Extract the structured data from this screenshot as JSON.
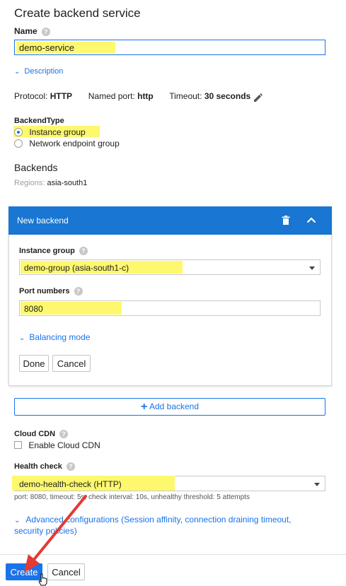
{
  "title": "Create backend service",
  "name": {
    "label": "Name",
    "value": "demo-service"
  },
  "description_link": "Description",
  "protocol": {
    "protocol_label": "Protocol:",
    "protocol_value": "HTTP",
    "port_label": "Named port:",
    "port_value": "http",
    "timeout_label": "Timeout:",
    "timeout_value": "30 seconds"
  },
  "backend_type": {
    "label": "BackendType",
    "options": [
      "Instance group",
      "Network endpoint group"
    ],
    "selected": "Instance group"
  },
  "backends": {
    "heading": "Backends",
    "regions_label": "Regions:",
    "regions_value": "asia-south1"
  },
  "new_backend": {
    "header": "New backend",
    "instance_group_label": "Instance group",
    "instance_group_value": "demo-group (asia-south1-c)",
    "port_numbers_label": "Port numbers",
    "port_numbers_value": "8080",
    "balancing_mode_link": "Balancing mode",
    "done_label": "Done",
    "cancel_label": "Cancel"
  },
  "add_backend_label": "Add backend",
  "cloud_cdn": {
    "label": "Cloud CDN",
    "checkbox_label": "Enable Cloud CDN"
  },
  "health_check": {
    "label": "Health check",
    "value": "demo-health-check (HTTP)",
    "details": "port: 8080, timeout: 5s, check interval: 10s, unhealthy threshold: 5 attempts"
  },
  "advanced": {
    "line1": "Advanced configurations (Session affinity, connection draining timeout,",
    "line2": "security policies)"
  },
  "footer": {
    "create_label": "Create",
    "cancel_label": "Cancel"
  },
  "colors": {
    "accent": "#1a73e8",
    "header_bg": "#1976d2",
    "highlight": "#fdf86e",
    "annotation_arrow": "#e53935"
  }
}
